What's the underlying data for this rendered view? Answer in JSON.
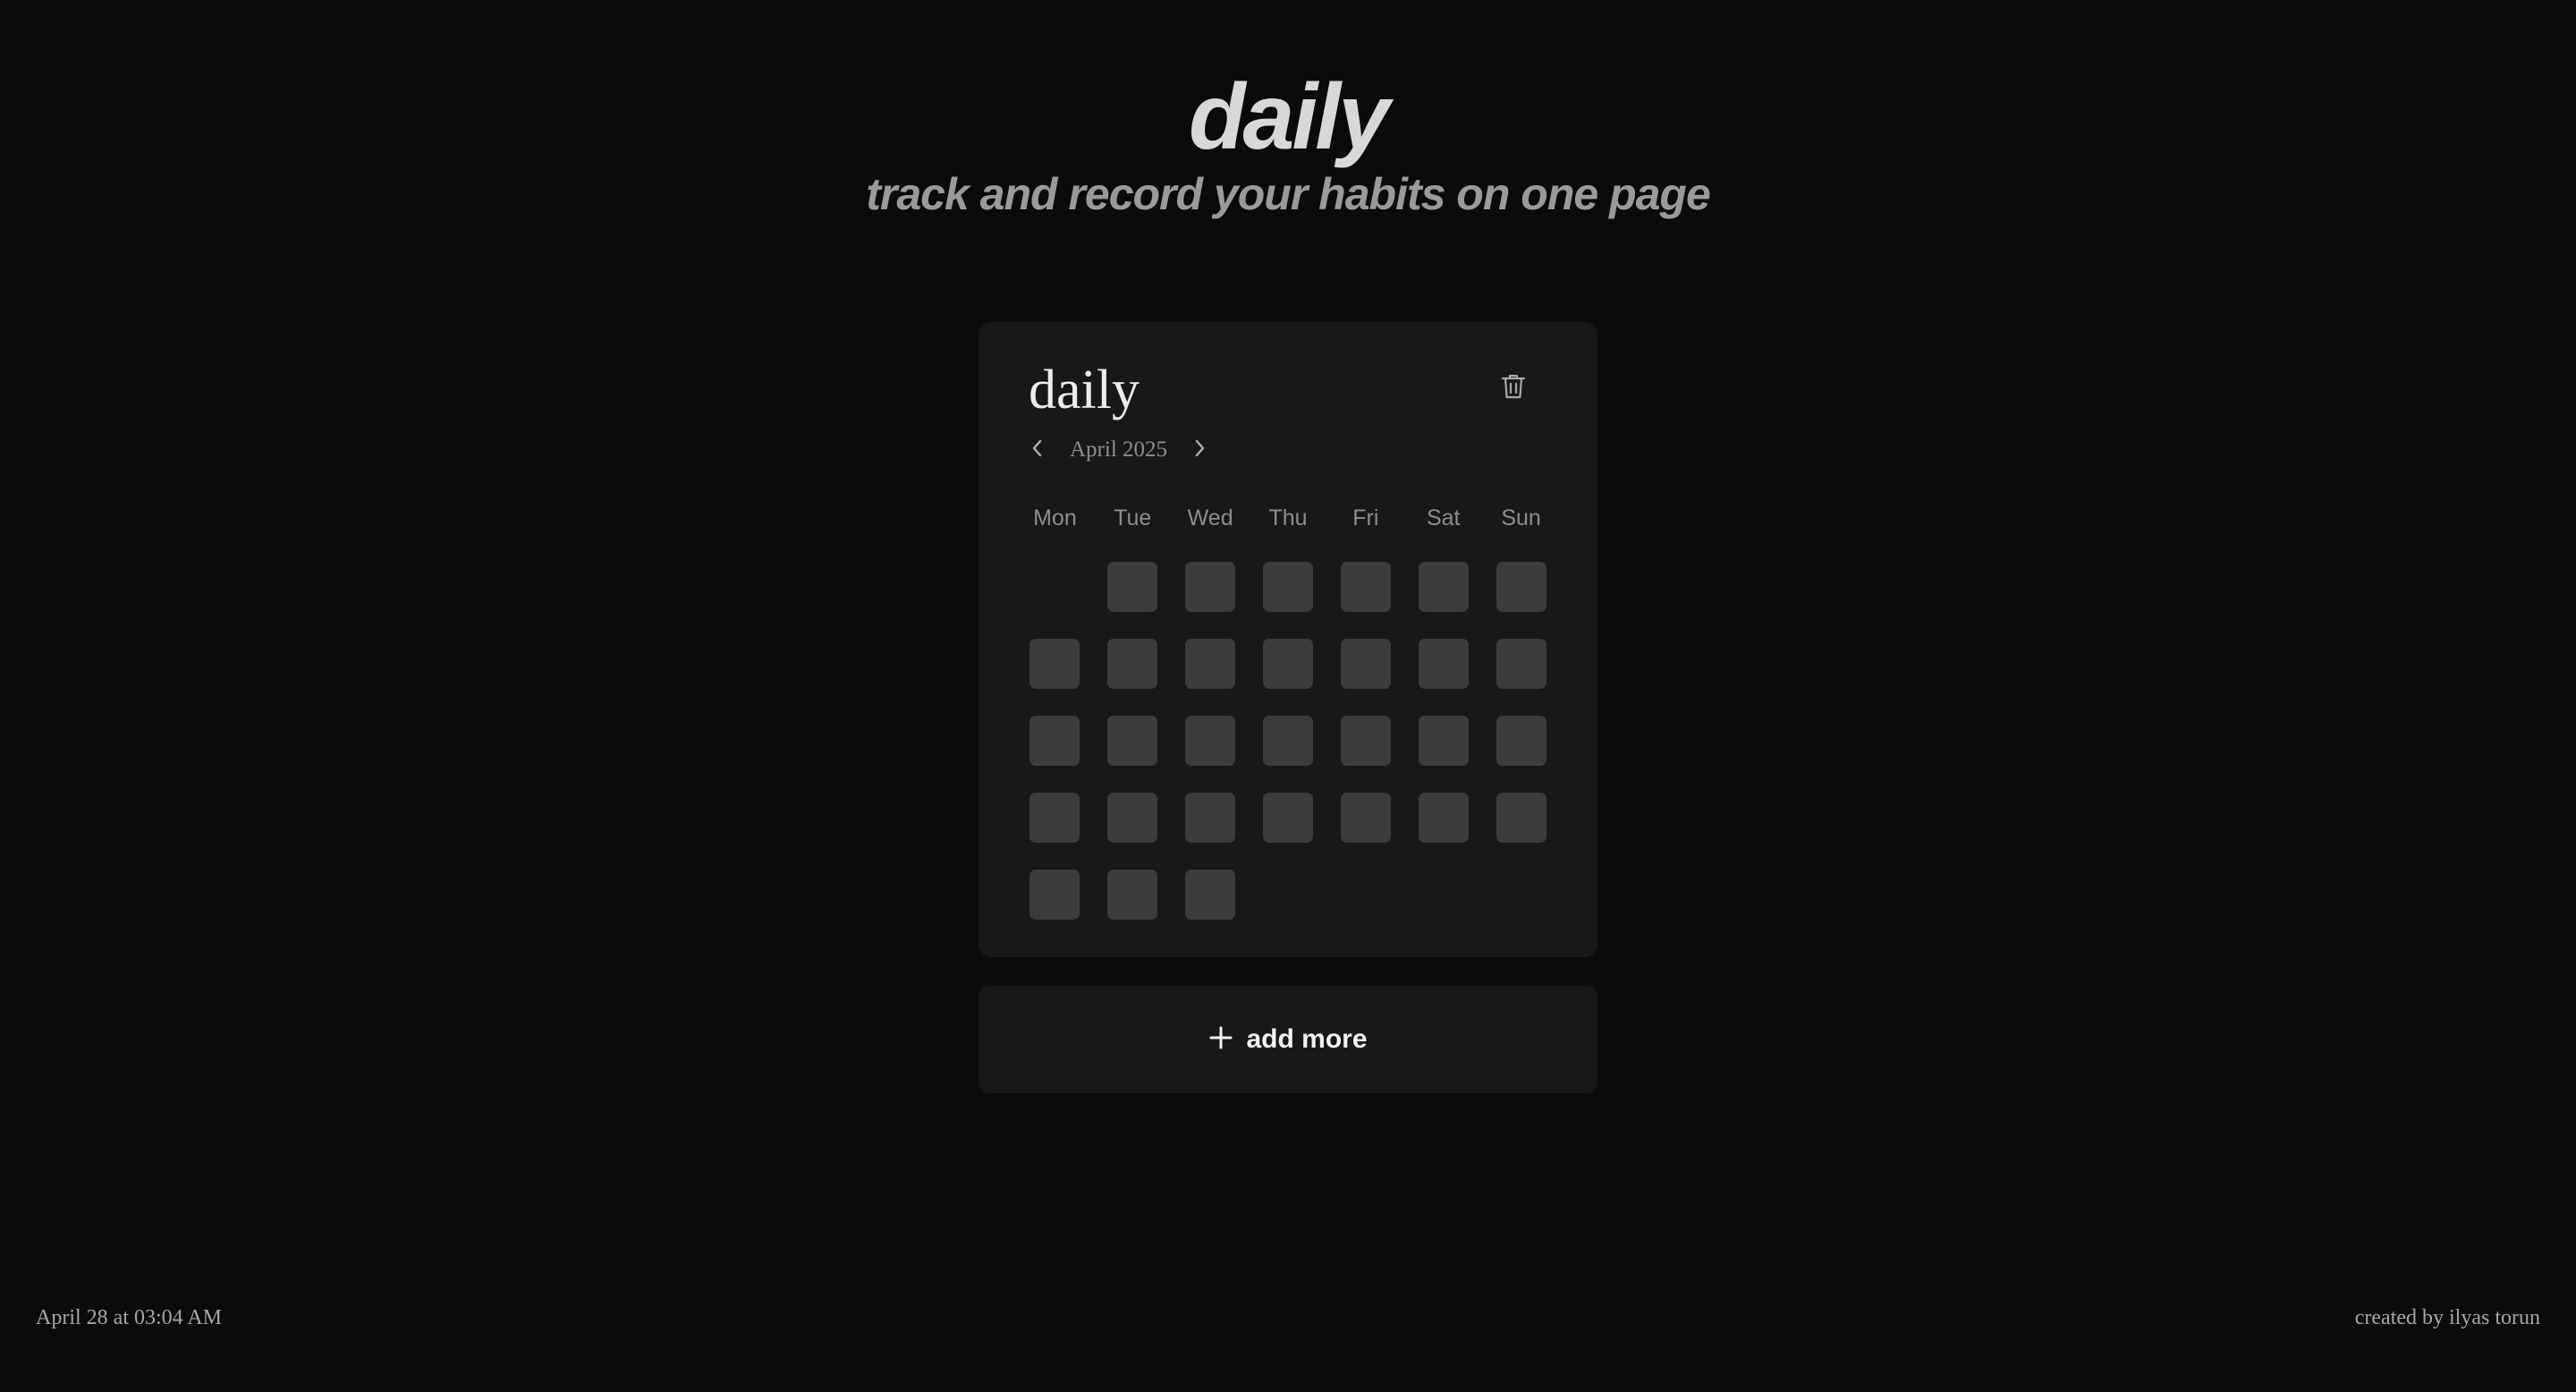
{
  "hero": {
    "title": "daily",
    "subtitle": "track and record your habits on one page"
  },
  "habit_card": {
    "title": "daily",
    "month_label": "April 2025",
    "delete_icon": "trash-icon",
    "prev_icon": "chevron-left-icon",
    "next_icon": "chevron-right-icon",
    "weekdays": [
      "Mon",
      "Tue",
      "Wed",
      "Thu",
      "Fri",
      "Sat",
      "Sun"
    ],
    "first_weekday_offset": 1,
    "days_in_month": 30,
    "completed_days": []
  },
  "add_more": {
    "label": "add more",
    "icon": "plus-icon"
  },
  "footer": {
    "timestamp": "April 28 at 03:04 AM",
    "credit": "created by ilyas torun"
  },
  "colors": {
    "background": "#0b0b0b",
    "card": "#181818",
    "day_cell": "#3c3c3c"
  }
}
